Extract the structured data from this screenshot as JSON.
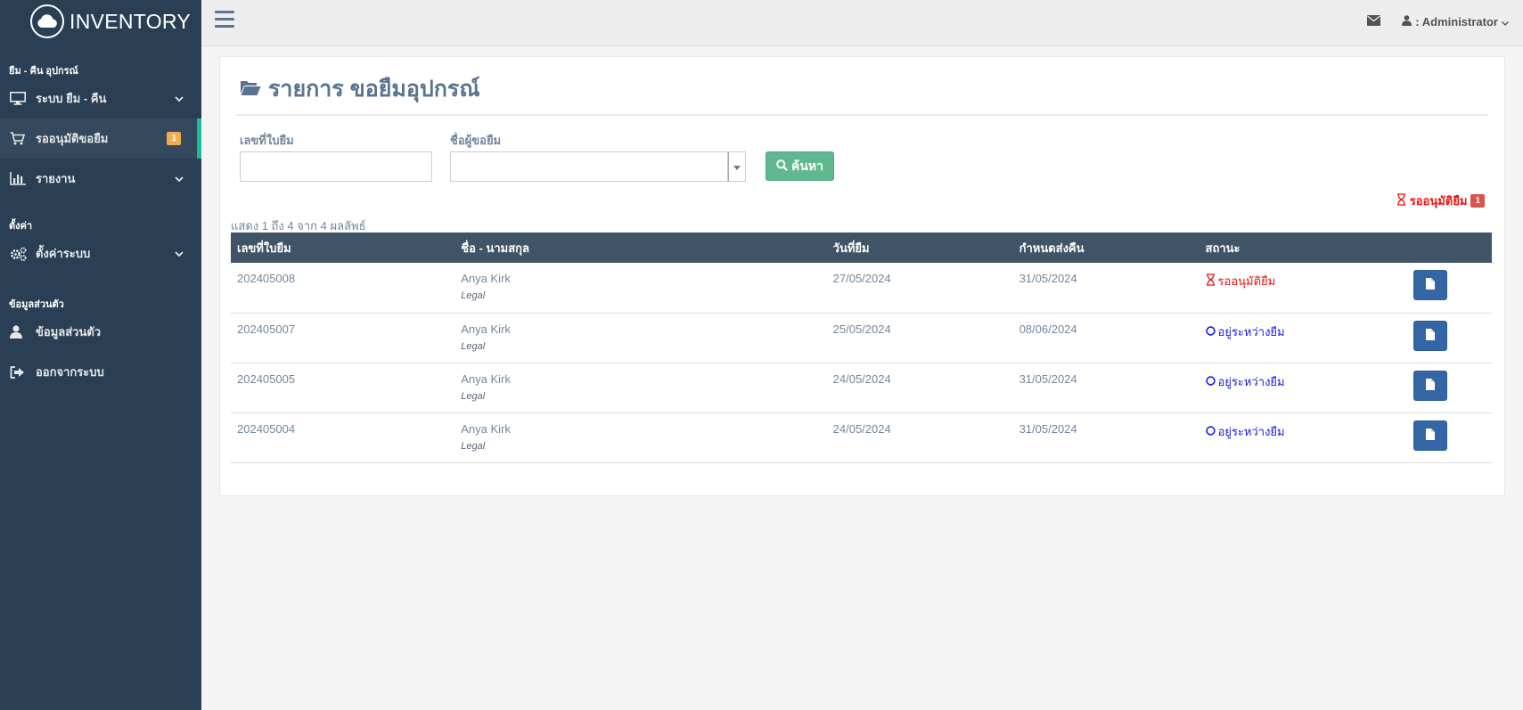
{
  "brand": {
    "title": "INVENTORY"
  },
  "sidebar": {
    "section1": "ยืม - คืน อุปกรณ์",
    "section2": "ตั้งค่า",
    "section3": "ข้อมูลส่วนตัว",
    "items": [
      {
        "label": "ระบบ ยืม - คืน",
        "icon": "monitor-icon"
      },
      {
        "label": "รออนุมัติขอยืม",
        "icon": "cart-icon",
        "badge": "1"
      },
      {
        "label": "รายงาน",
        "icon": "bar-chart-icon"
      },
      {
        "label": "ตั้งค่าระบบ",
        "icon": "gears-icon"
      },
      {
        "label": "ข้อมูลส่วนตัว",
        "icon": "user-icon"
      },
      {
        "label": "ออกจากระบบ",
        "icon": "sign-out-icon"
      }
    ]
  },
  "topbar": {
    "user": ": Administrator"
  },
  "main": {
    "title": "รายการ ขอยืมอุปกรณ์",
    "form": {
      "doc_label": "เลขที่ใบยืม",
      "doc_value": "",
      "borrower_label": "ชื่อผู้ขอยืม",
      "borrower_value": "",
      "search_label": "ค้นหา"
    },
    "pending_note": "รออนุมัติยืม",
    "pending_count": "1",
    "result_info": "แสดง 1 ถึง 4 จาก 4 ผลลัพธ์",
    "columns": [
      "เลขที่ใบยืม",
      "ชื่อ - นามสกุล",
      "วันที่ยืม",
      "กำหนดส่งคืน",
      "สถานะ"
    ],
    "rows": [
      {
        "id": "202405008",
        "name": "Anya Kirk",
        "dept": "Legal",
        "borrow_date": "27/05/2024",
        "due_date": "31/05/2024",
        "status": "รออนุมัติยืม",
        "status_type": "pending"
      },
      {
        "id": "202405007",
        "name": "Anya Kirk",
        "dept": "Legal",
        "borrow_date": "25/05/2024",
        "due_date": "08/06/2024",
        "status": "อยู่ระหว่างยืม",
        "status_type": "borrowing"
      },
      {
        "id": "202405005",
        "name": "Anya Kirk",
        "dept": "Legal",
        "borrow_date": "24/05/2024",
        "due_date": "31/05/2024",
        "status": "อยู่ระหว่างยืม",
        "status_type": "borrowing"
      },
      {
        "id": "202405004",
        "name": "Anya Kirk",
        "dept": "Legal",
        "borrow_date": "24/05/2024",
        "due_date": "31/05/2024",
        "status": "อยู่ระหว่างยืม",
        "status_type": "borrowing"
      }
    ]
  },
  "colors": {
    "sidebar": "#2a3f54",
    "active_accent": "#1abb9c",
    "pending": "#ee1111",
    "borrowing": "#1a1ae6",
    "header": "#405467"
  }
}
